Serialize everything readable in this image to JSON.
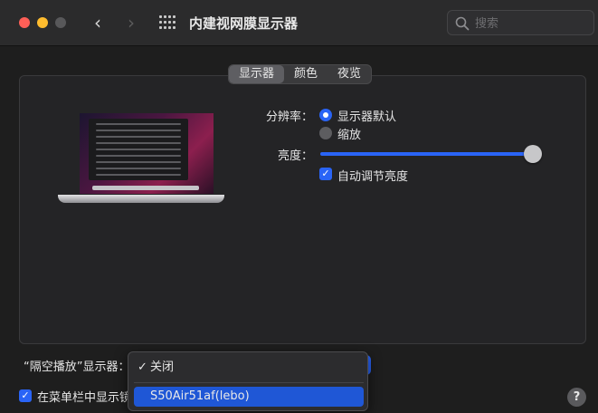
{
  "window": {
    "title": "内建视网膜显示器",
    "back_icon": "‹",
    "forward_icon": "›"
  },
  "search": {
    "placeholder": "搜索"
  },
  "tabs": [
    {
      "label": "显示器",
      "active": true
    },
    {
      "label": "颜色",
      "active": false
    },
    {
      "label": "夜览",
      "active": false
    }
  ],
  "resolution": {
    "label": "分辨率：",
    "options": [
      {
        "label": "显示器默认",
        "selected": true
      },
      {
        "label": "缩放",
        "selected": false
      }
    ]
  },
  "brightness": {
    "label": "亮度：",
    "level_percent": 100,
    "auto_label": "自动调节亮度",
    "auto_checked": true
  },
  "airplay": {
    "label": "“隔空播放”显示器：",
    "menu": [
      {
        "label": "关闭",
        "checked": true,
        "highlighted": false
      },
      {
        "label": "S50Air51af(lebo)",
        "checked": false,
        "highlighted": true
      }
    ]
  },
  "menubar_option": {
    "label": "在菜单栏中显示镜",
    "checked": true
  },
  "help": {
    "label": "?"
  },
  "colors": {
    "accent": "#2a64f6",
    "window_bg": "#1e1e1e"
  }
}
